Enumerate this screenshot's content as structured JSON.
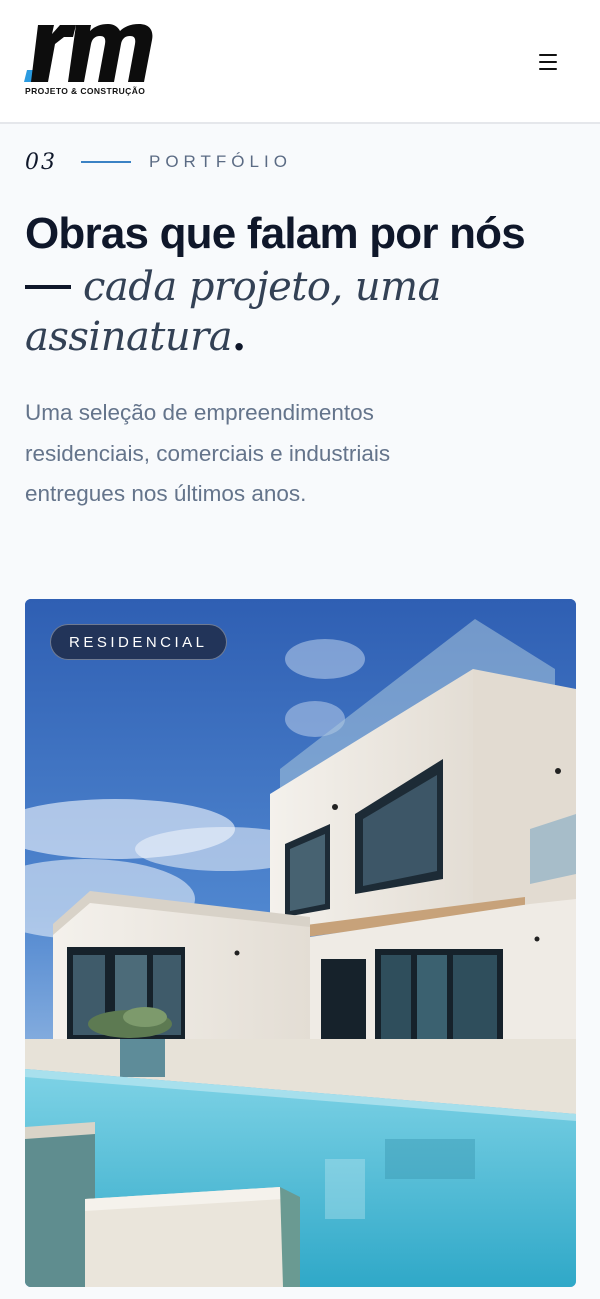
{
  "header": {
    "logo_text": "rm",
    "logo_tagline": "PROJETO & CONSTRUÇÃO",
    "menu_icon": "hamburger-menu-icon"
  },
  "section": {
    "number": "03",
    "label": "PORTFÓLIO"
  },
  "headline": {
    "line1": "Obras que falam por nós",
    "line2_italic": "cada projeto, uma",
    "line3_italic": "assinatura",
    "line3_end": "."
  },
  "lede": "Uma seleção de empreendimentos residenciais, comerciais e industriais entregues nos últimos anos.",
  "project_card": {
    "badge": "RESIDENCIAL",
    "image": "modern-white-house-with-pool"
  },
  "colors": {
    "accent": "#3b82c4",
    "logo_accent": "#2b9be0",
    "ink": "#0f172a",
    "muted": "#64748b",
    "badge_bg": "#1e2944"
  }
}
